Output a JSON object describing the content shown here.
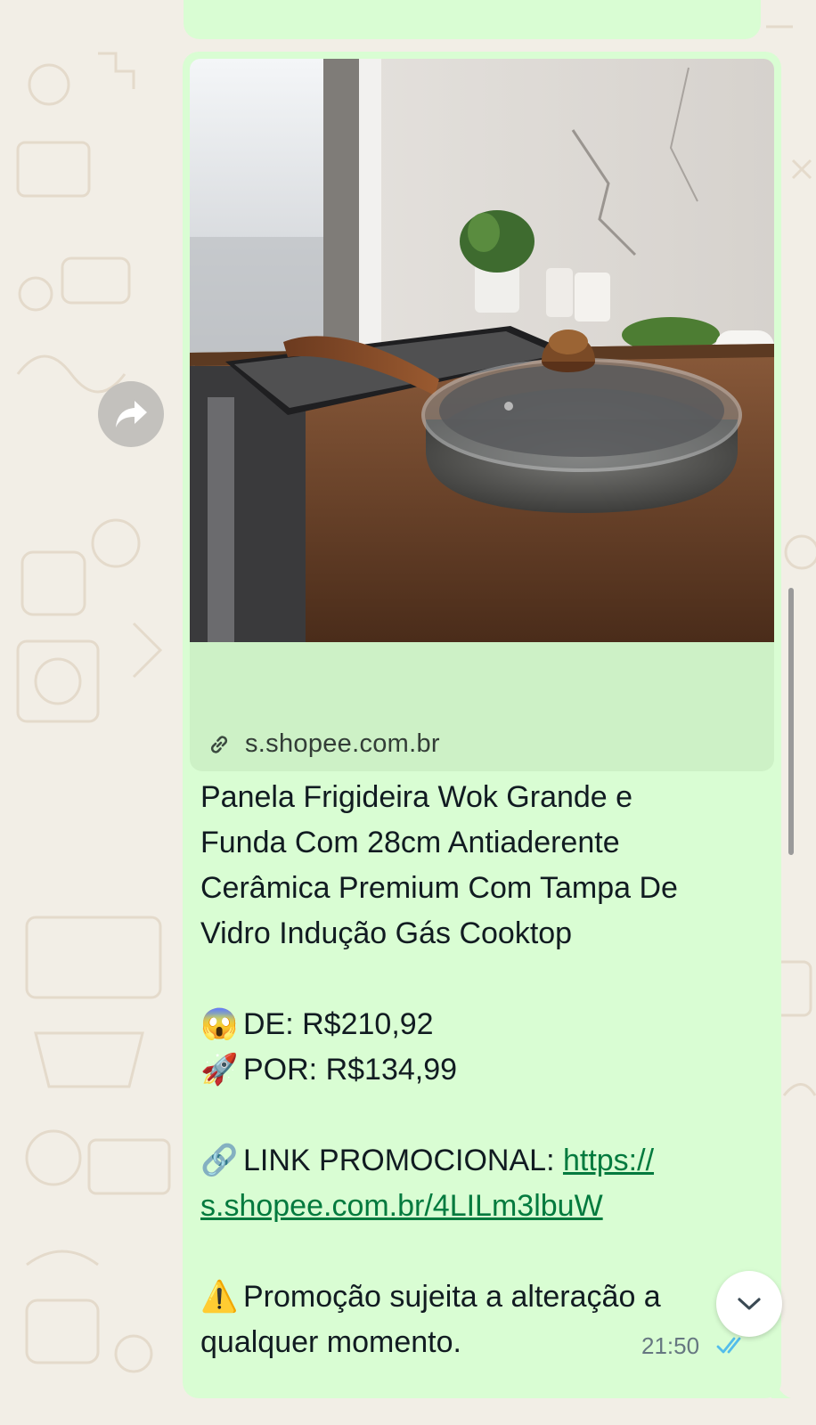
{
  "message": {
    "preview": {
      "image_icon": "wok-pan-product-photo",
      "domain": "s.shopee.com.br",
      "link_icon": "link-icon"
    },
    "title_lines": [
      "Panela Frigideira Wok Grande e",
      "Funda Com 28cm Antiaderente",
      "Cerâmica Premium Com Tampa De",
      "Vidro Indução Gás Cooktop"
    ],
    "price_from": {
      "emoji": "😱",
      "text": "DE: R$210,92"
    },
    "price_to": {
      "emoji": "🚀",
      "text": "POR: R$134,99"
    },
    "promo_link": {
      "emoji": "🔗",
      "label": "LINK PROMOCIONAL: ",
      "url_part1": "https://",
      "url_part2": "s.shopee.com.br/4LILm3lbuW"
    },
    "warning": {
      "emoji": "⚠️",
      "line1": "Promoção sujeita a alteração a",
      "line2": "qualquer momento."
    },
    "time": "21:50",
    "status_icon": "double-check-read-icon"
  },
  "colors": {
    "bubble": "#d9fdd3",
    "link": "#027a3e",
    "read_ticks": "#53bdeb"
  }
}
